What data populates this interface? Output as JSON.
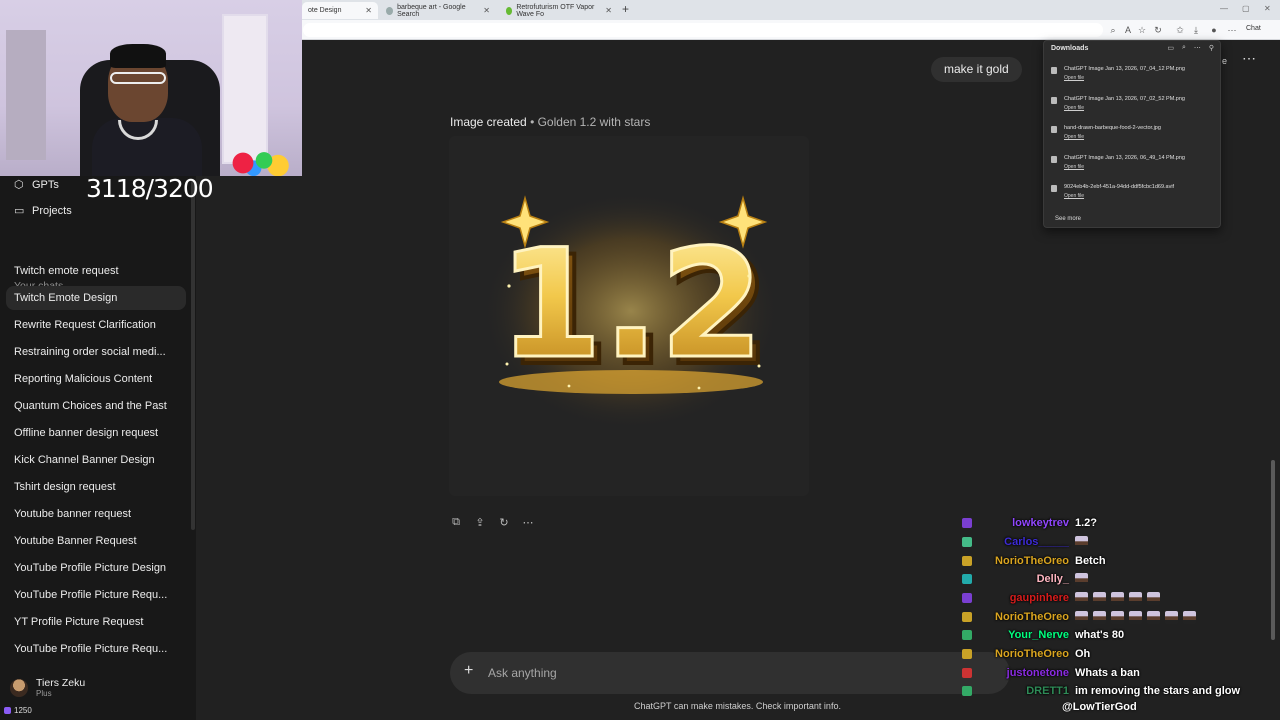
{
  "browser": {
    "tabs": [
      {
        "label": "ote Design",
        "active": true
      },
      {
        "label": "barbeque art - Google Search",
        "active": false
      },
      {
        "label": "Retrofuturism OTF Vapor Wave Fo",
        "active": false
      }
    ],
    "chat_button": "Chat"
  },
  "stream": {
    "counter": "3118/3200"
  },
  "sidebar": {
    "top_items": [
      {
        "label": "GPTs",
        "icon": "cube-icon"
      },
      {
        "label": "Projects",
        "icon": "folder-icon"
      }
    ],
    "section_label": "Your chats",
    "chats": [
      "Twitch emote request",
      "Twitch Emote Design",
      "Rewrite Request Clarification",
      "Restraining order social medi...",
      "Reporting Malicious Content",
      "Quantum Choices and the Past",
      "Offline banner design request",
      "Kick Channel Banner Design",
      "Tshirt design request",
      "Youtube banner request",
      "Youtube Banner Request",
      "YouTube Profile Picture Design",
      "YouTube Profile Picture Requ...",
      "YT Profile Picture Request",
      "YouTube Profile Picture Requ..."
    ],
    "user": {
      "name": "Tiers Zeku",
      "plan": "Plus"
    },
    "sub_count": "1250"
  },
  "conversation": {
    "user_message": "make it gold",
    "image_header": "Image created",
    "image_subtitle": "• Golden 1.2 with stars",
    "image_text": "1.2",
    "composer_placeholder": "Ask anything",
    "disclaimer": "ChatGPT can make mistakes. Check important info."
  },
  "downloads": {
    "title": "Downloads",
    "items": [
      {
        "name": "ChatGPT Image Jan 13, 2026, 07_04_12 PM.png",
        "action": "Open file"
      },
      {
        "name": "ChatGPT Image Jan 13, 2026, 07_02_52 PM.png",
        "action": "Open file"
      },
      {
        "name": "hand-drawn-barbeque-food-2-vector.jpg",
        "action": "Open file"
      },
      {
        "name": "ChatGPT Image Jan 13, 2026, 06_49_14 PM.png",
        "action": "Open file"
      },
      {
        "name": "9024eb4b-2ebf-451a-94dd-ddf5fcbc1d69.avif",
        "action": "Open file"
      }
    ],
    "see_more": "See more",
    "edge_fragment": "e"
  },
  "twitch_chat": {
    "lines": [
      {
        "user": "lowkeytrev",
        "color": "#9147ff",
        "message": "1.2?",
        "emotes": 0
      },
      {
        "user": "Carlos_____",
        "color": "#3d2bd6",
        "message": "",
        "emotes": 1
      },
      {
        "user": "NorioTheOreo",
        "color": "#daa520",
        "message": "Betch",
        "emotes": 0
      },
      {
        "user": "Delly_",
        "color": "#ffb6c1",
        "message": "",
        "emotes": 1
      },
      {
        "user": "gaupinhere",
        "color": "#d61c1c",
        "message": "",
        "emotes": 5
      },
      {
        "user": "NorioTheOreo",
        "color": "#daa520",
        "message": "",
        "emotes": 7
      },
      {
        "user": "Your_Nerve",
        "color": "#00ff7f",
        "message": "what's 80",
        "emotes": 0
      },
      {
        "user": "NorioTheOreo",
        "color": "#daa520",
        "message": "Oh",
        "emotes": 0
      },
      {
        "user": "justonetone",
        "color": "#8a2be2",
        "message": "Whats a ban",
        "emotes": 0
      },
      {
        "user": "DRETT1",
        "color": "#2e8b57",
        "message": "im removing the stars and glow",
        "emotes": 0
      }
    ],
    "mention": "@LowTierGod"
  },
  "colors": {
    "gold": "#f2c84b",
    "gold_dark": "#8a5a12",
    "bg": "#212121",
    "sidebar": "#181818"
  }
}
